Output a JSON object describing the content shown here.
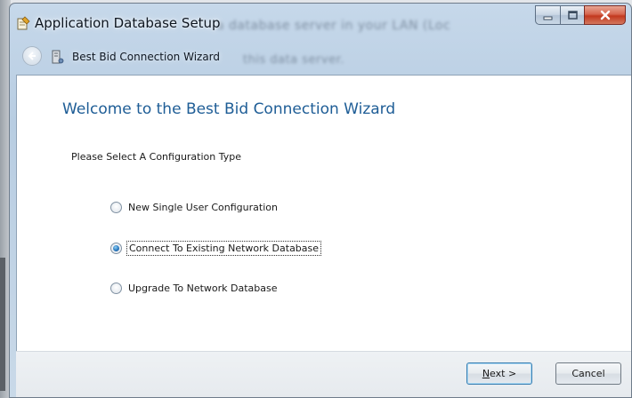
{
  "window": {
    "title": "Application Database Setup",
    "background_text_1": "a database server in your LAN (Loc",
    "background_text_2": "this data server."
  },
  "nav": {
    "title": "Best Bid Connection Wizard"
  },
  "content": {
    "heading": "Welcome to the Best Bid Connection Wizard",
    "prompt": "Please Select A Configuration Type",
    "options": [
      {
        "label": "New Single User Configuration",
        "checked": false
      },
      {
        "label": "Connect To Existing Network Database",
        "checked": true
      },
      {
        "label": "Upgrade To Network Database",
        "checked": false
      }
    ]
  },
  "footer": {
    "next_mnemonic": "N",
    "next_rest": "ext >",
    "cancel_label": "Cancel"
  },
  "colors": {
    "heading": "#1e5d96",
    "close_button": "#c2391f"
  }
}
